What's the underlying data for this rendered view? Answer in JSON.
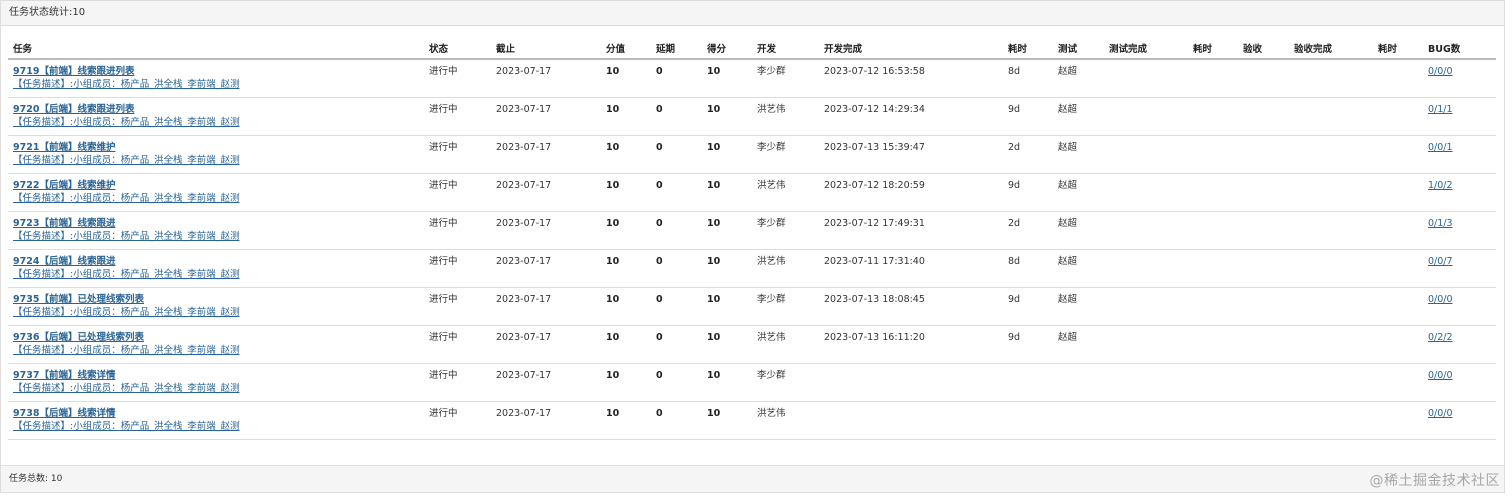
{
  "header": {
    "title": "任务状态统计:10"
  },
  "table": {
    "columns": [
      "任务",
      "状态",
      "截止",
      "分值",
      "延期",
      "得分",
      "开发",
      "开发完成",
      "耗时",
      "测试",
      "测试完成",
      "耗时",
      "验收",
      "验收完成",
      "耗时",
      "BUG数"
    ],
    "rows": [
      {
        "title": "9719【前端】线索跟进列表",
        "desc": "【任务描述】:小组成员：杨产品_洪全栈_李前端_赵测",
        "status": "进行中",
        "deadline": "2023-07-17",
        "score": "10",
        "delay": "0",
        "points": "10",
        "dev": "李少群",
        "dev_done": "2023-07-12 16:53:58",
        "dev_time": "8d",
        "tester": "赵超",
        "test_done": "",
        "test_time": "",
        "accept": "",
        "accept_done": "",
        "accept_time": "",
        "bugs": "0/0/0"
      },
      {
        "title": "9720【后端】线索跟进列表",
        "desc": "【任务描述】:小组成员：杨产品_洪全栈_李前端_赵测",
        "status": "进行中",
        "deadline": "2023-07-17",
        "score": "10",
        "delay": "0",
        "points": "10",
        "dev": "洪艺伟",
        "dev_done": "2023-07-12 14:29:34",
        "dev_time": "9d",
        "tester": "赵超",
        "test_done": "",
        "test_time": "",
        "accept": "",
        "accept_done": "",
        "accept_time": "",
        "bugs": "0/1/1"
      },
      {
        "title": "9721【前端】线索维护",
        "desc": "【任务描述】:小组成员：杨产品_洪全栈_李前端_赵测",
        "status": "进行中",
        "deadline": "2023-07-17",
        "score": "10",
        "delay": "0",
        "points": "10",
        "dev": "李少群",
        "dev_done": "2023-07-13 15:39:47",
        "dev_time": "2d",
        "tester": "赵超",
        "test_done": "",
        "test_time": "",
        "accept": "",
        "accept_done": "",
        "accept_time": "",
        "bugs": "0/0/1"
      },
      {
        "title": "9722【后端】线索维护",
        "desc": "【任务描述】:小组成员：杨产品_洪全栈_李前端_赵测",
        "status": "进行中",
        "deadline": "2023-07-17",
        "score": "10",
        "delay": "0",
        "points": "10",
        "dev": "洪艺伟",
        "dev_done": "2023-07-12 18:20:59",
        "dev_time": "9d",
        "tester": "赵超",
        "test_done": "",
        "test_time": "",
        "accept": "",
        "accept_done": "",
        "accept_time": "",
        "bugs": "1/0/2"
      },
      {
        "title": "9723【前端】线索跟进",
        "desc": "【任务描述】:小组成员：杨产品_洪全栈_李前端_赵测",
        "status": "进行中",
        "deadline": "2023-07-17",
        "score": "10",
        "delay": "0",
        "points": "10",
        "dev": "李少群",
        "dev_done": "2023-07-12 17:49:31",
        "dev_time": "2d",
        "tester": "赵超",
        "test_done": "",
        "test_time": "",
        "accept": "",
        "accept_done": "",
        "accept_time": "",
        "bugs": "0/1/3"
      },
      {
        "title": "9724【后端】线索跟进",
        "desc": "【任务描述】:小组成员：杨产品_洪全栈_李前端_赵测",
        "status": "进行中",
        "deadline": "2023-07-17",
        "score": "10",
        "delay": "0",
        "points": "10",
        "dev": "洪艺伟",
        "dev_done": "2023-07-11 17:31:40",
        "dev_time": "8d",
        "tester": "赵超",
        "test_done": "",
        "test_time": "",
        "accept": "",
        "accept_done": "",
        "accept_time": "",
        "bugs": "0/0/7"
      },
      {
        "title": "9735【前端】已处理线索列表",
        "desc": "【任务描述】:小组成员：杨产品_洪全栈_李前端_赵测",
        "status": "进行中",
        "deadline": "2023-07-17",
        "score": "10",
        "delay": "0",
        "points": "10",
        "dev": "李少群",
        "dev_done": "2023-07-13 18:08:45",
        "dev_time": "9d",
        "tester": "赵超",
        "test_done": "",
        "test_time": "",
        "accept": "",
        "accept_done": "",
        "accept_time": "",
        "bugs": "0/0/0"
      },
      {
        "title": "9736【后端】已处理线索列表",
        "desc": "【任务描述】:小组成员：杨产品_洪全栈_李前端_赵测",
        "status": "进行中",
        "deadline": "2023-07-17",
        "score": "10",
        "delay": "0",
        "points": "10",
        "dev": "洪艺伟",
        "dev_done": "2023-07-13 16:11:20",
        "dev_time": "9d",
        "tester": "赵超",
        "test_done": "",
        "test_time": "",
        "accept": "",
        "accept_done": "",
        "accept_time": "",
        "bugs": "0/2/2"
      },
      {
        "title": "9737【前端】线索详情",
        "desc": "【任务描述】:小组成员：杨产品_洪全栈_李前端_赵测",
        "status": "进行中",
        "deadline": "2023-07-17",
        "score": "10",
        "delay": "0",
        "points": "10",
        "dev": "李少群",
        "dev_done": "",
        "dev_time": "",
        "tester": "",
        "test_done": "",
        "test_time": "",
        "accept": "",
        "accept_done": "",
        "accept_time": "",
        "bugs": "0/0/0"
      },
      {
        "title": "9738【后端】线索详情",
        "desc": "【任务描述】:小组成员：杨产品_洪全栈_李前端_赵测",
        "status": "进行中",
        "deadline": "2023-07-17",
        "score": "10",
        "delay": "0",
        "points": "10",
        "dev": "洪艺伟",
        "dev_done": "",
        "dev_time": "",
        "tester": "",
        "test_done": "",
        "test_time": "",
        "accept": "",
        "accept_done": "",
        "accept_time": "",
        "bugs": "0/0/0"
      }
    ]
  },
  "footer": {
    "total": "任务总数:  10"
  },
  "watermark": "@稀土掘金技术社区",
  "colors": {
    "link": "#2a6496",
    "header_bg": "#f5f5f5",
    "border": "#dddddd"
  }
}
